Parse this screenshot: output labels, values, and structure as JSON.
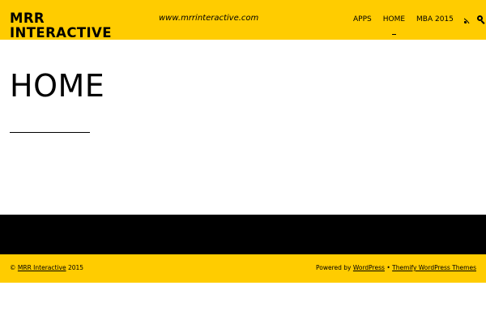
{
  "header": {
    "logo_line1": "MRR",
    "logo_line2": "INTERACTIVE",
    "tagline": "www.mrrinteractive.com",
    "nav": [
      {
        "label": "APPS"
      },
      {
        "label": "HOME",
        "current": true
      },
      {
        "label": "MBA 2015"
      }
    ],
    "icons": [
      "rss-icon",
      "search-icon"
    ]
  },
  "main": {
    "title": "HOME"
  },
  "footer": {
    "copyright_prefix": "©",
    "site_link": "MRR Interactive",
    "year": "2015",
    "powered_by": "Powered by",
    "wordpress_link": "WordPress",
    "separator": "•",
    "theme_link": "Themify WordPress Themes"
  },
  "colors": {
    "accent": "#ffcc00",
    "dark": "#000000",
    "background": "#ffffff"
  }
}
